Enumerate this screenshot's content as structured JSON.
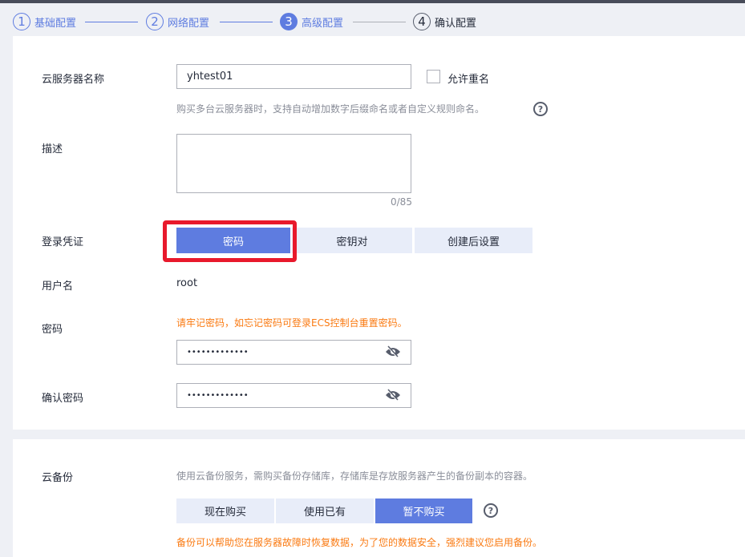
{
  "steps": [
    {
      "num": "1",
      "label": "基础配置"
    },
    {
      "num": "2",
      "label": "网络配置"
    },
    {
      "num": "3",
      "label": "高级配置"
    },
    {
      "num": "4",
      "label": "确认配置"
    }
  ],
  "form": {
    "name_label": "云服务器名称",
    "name_value": "yhtest01",
    "allow_dup_label": "允许重名",
    "name_hint": "购买多台云服务器时，支持自动增加数字后缀命名或者自定义规则命名。",
    "desc_label": "描述",
    "desc_counter": "0/85",
    "login_label": "登录凭证",
    "login_options": [
      "密码",
      "密钥对",
      "创建后设置"
    ],
    "username_label": "用户名",
    "username_value": "root",
    "password_label": "密码",
    "password_warning": "请牢记密码，如忘记密码可登录ECS控制台重置密码。",
    "password_value": "•••••••••••••",
    "confirm_label": "确认密码",
    "confirm_value": "•••••••••••••"
  },
  "backup": {
    "label": "云备份",
    "desc": "使用云备份服务，需购买备份存储库，存储库是存放服务器产生的备份副本的容器。",
    "options": [
      "现在购买",
      "使用已有",
      "暂不购买"
    ],
    "warning": "备份可以帮助您在服务器故障时恢复数据，为了您的数据安全，强烈建议您启用备份。"
  },
  "colors": {
    "accent": "#5e7ce0",
    "warning": "#fa7a12",
    "highlight": "#e8192c"
  }
}
